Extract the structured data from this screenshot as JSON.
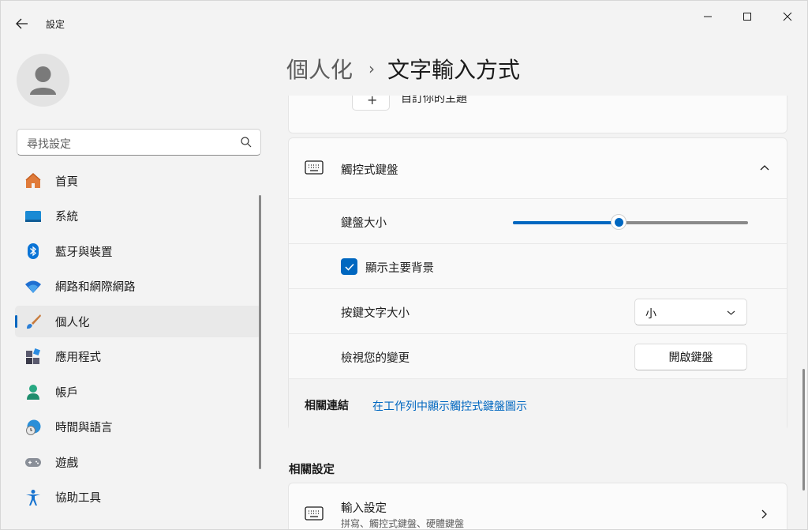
{
  "app": {
    "title": "設定"
  },
  "window": {
    "minimize": "minimize",
    "maximize": "maximize",
    "close": "close"
  },
  "search": {
    "placeholder": "尋找設定"
  },
  "nav": {
    "items": [
      {
        "label": "首頁",
        "icon": "home-icon",
        "active": false
      },
      {
        "label": "系統",
        "icon": "system-icon",
        "active": false
      },
      {
        "label": "藍牙與裝置",
        "icon": "bluetooth-icon",
        "active": false
      },
      {
        "label": "網路和網際網路",
        "icon": "wifi-icon",
        "active": false
      },
      {
        "label": "個人化",
        "icon": "brush-icon",
        "active": true
      },
      {
        "label": "應用程式",
        "icon": "apps-icon",
        "active": false
      },
      {
        "label": "帳戶",
        "icon": "account-icon",
        "active": false
      },
      {
        "label": "時間與語言",
        "icon": "time-language-icon",
        "active": false
      },
      {
        "label": "遊戲",
        "icon": "gamepad-icon",
        "active": false
      },
      {
        "label": "協助工具",
        "icon": "accessibility-icon",
        "active": false
      }
    ]
  },
  "breadcrumb": {
    "parent": "個人化",
    "separator": "›",
    "current": "文字輸入方式"
  },
  "previous_card": {
    "button_symbol": "+",
    "text": "自訂你的主題"
  },
  "touch_keyboard": {
    "title": "觸控式鍵盤",
    "size_label": "鍵盤大小",
    "size_value": 0.45,
    "show_theme_label": "顯示主要背景",
    "show_theme_checked": true,
    "key_text_size_label": "按鍵文字大小",
    "key_text_size_value": "小",
    "preview_label": "檢視您的變更",
    "open_keyboard_button": "開啟鍵盤",
    "related_links_label": "相關連結",
    "related_link": "在工作列中顯示觸控式鍵盤圖示"
  },
  "related_settings": {
    "title": "相關設定",
    "input_title": "輸入設定",
    "input_subtitle": "拼寫、觸控式鍵盤、硬體鍵盤"
  },
  "colors": {
    "accent": "#0067c0",
    "background": "#f3f3f3",
    "card": "#fbfbfb"
  }
}
